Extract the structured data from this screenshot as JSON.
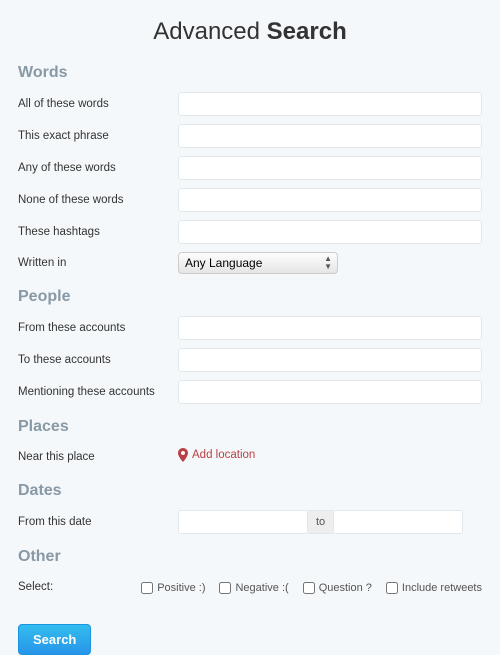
{
  "title": {
    "light": "Advanced ",
    "bold": "Search"
  },
  "sections": {
    "words": {
      "heading": "Words",
      "all": "All of these words",
      "exact": "This exact phrase",
      "any": "Any of these words",
      "none": "None of these words",
      "hashtags": "These hashtags",
      "written_in": "Written in",
      "language_selected": "Any Language"
    },
    "people": {
      "heading": "People",
      "from": "From these accounts",
      "to": "To these accounts",
      "mentioning": "Mentioning these accounts"
    },
    "places": {
      "heading": "Places",
      "near": "Near this place",
      "add_location": "Add location"
    },
    "dates": {
      "heading": "Dates",
      "from": "From this date",
      "sep": "to"
    },
    "other": {
      "heading": "Other",
      "select": "Select:",
      "positive": "Positive :)",
      "negative": "Negative :(",
      "question": "Question ?",
      "retweets": "Include retweets"
    }
  },
  "buttons": {
    "search": "Search"
  },
  "colors": {
    "accent": "#1da1f2",
    "section": "#8899a6",
    "location": "#b94044"
  }
}
